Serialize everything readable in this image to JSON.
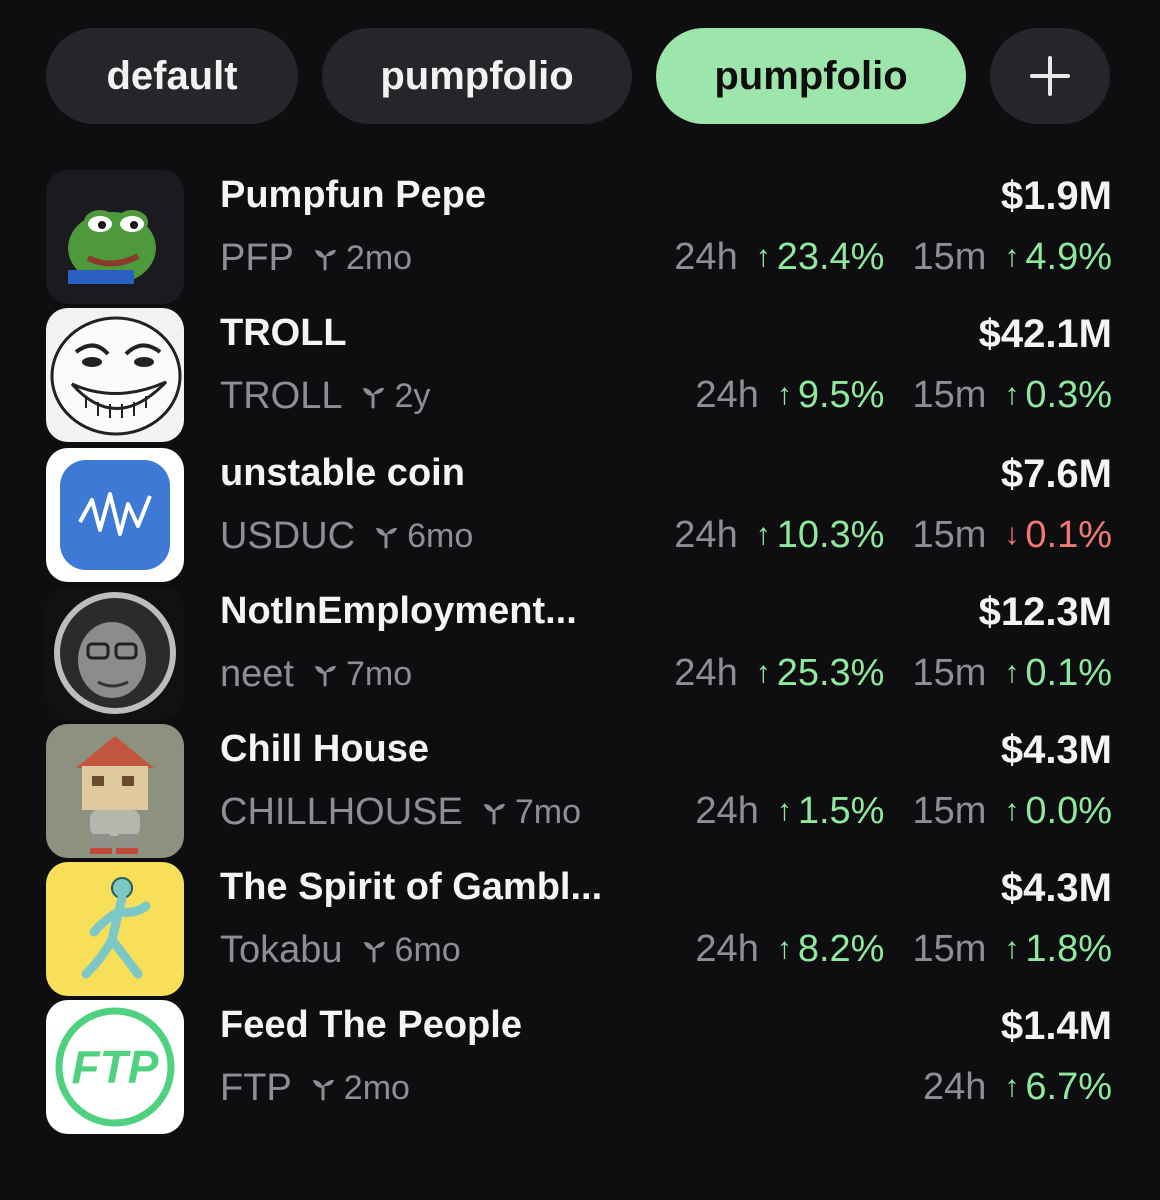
{
  "tabs": [
    {
      "label": "default",
      "active": false
    },
    {
      "label": "pumpfolio",
      "active": false
    },
    {
      "label": "pumpfolio",
      "active": true
    }
  ],
  "add_tab_icon": "plus-icon",
  "colors": {
    "accent": "#9ce6ab",
    "up": "#8ee89e",
    "down": "#f07a73",
    "muted": "#8e8e95",
    "background": "#0e0e11"
  },
  "coins": [
    {
      "name": "Pumpfun Pepe",
      "ticker": "PFP",
      "age": "2mo",
      "mcap": "$1.9M",
      "label_24h": "24h",
      "change_24h": "23.4%",
      "dir_24h": "up",
      "label_15m": "15m",
      "change_15m": "4.9%",
      "dir_15m": "up",
      "icon": "pepe-frog-icon"
    },
    {
      "name": "TROLL",
      "ticker": "TROLL",
      "age": "2y",
      "mcap": "$42.1M",
      "label_24h": "24h",
      "change_24h": "9.5%",
      "dir_24h": "up",
      "label_15m": "15m",
      "change_15m": "0.3%",
      "dir_15m": "up",
      "icon": "trollface-icon"
    },
    {
      "name": "unstable coin",
      "ticker": "USDUC",
      "age": "6mo",
      "mcap": "$7.6M",
      "label_24h": "24h",
      "change_24h": "10.3%",
      "dir_24h": "up",
      "label_15m": "15m",
      "change_15m": "0.1%",
      "dir_15m": "down",
      "icon": "zigzag-chart-icon"
    },
    {
      "name": "NotInEmployment...",
      "ticker": "neet",
      "age": "7mo",
      "mcap": "$12.3M",
      "label_24h": "24h",
      "change_24h": "25.3%",
      "dir_24h": "up",
      "label_15m": "15m",
      "change_15m": "0.1%",
      "dir_15m": "up",
      "icon": "neet-face-icon"
    },
    {
      "name": "Chill House",
      "ticker": "CHILLHOUSE",
      "age": "7mo",
      "mcap": "$4.3M",
      "label_24h": "24h",
      "change_24h": "1.5%",
      "dir_24h": "up",
      "label_15m": "15m",
      "change_15m": "0.0%",
      "dir_15m": "up",
      "icon": "house-head-icon"
    },
    {
      "name": "The Spirit of Gambl...",
      "ticker": "Tokabu",
      "age": "6mo",
      "mcap": "$4.3M",
      "label_24h": "24h",
      "change_24h": "8.2%",
      "dir_24h": "up",
      "label_15m": "15m",
      "change_15m": "1.8%",
      "dir_15m": "up",
      "icon": "running-spirit-icon"
    },
    {
      "name": "Feed The People",
      "ticker": "FTP",
      "age": "2mo",
      "mcap": "$1.4M",
      "label_24h": "24h",
      "change_24h": "6.7%",
      "dir_24h": "up",
      "label_15m": "",
      "change_15m": "",
      "dir_15m": "",
      "icon": "ftp-logo-icon",
      "logo_text": "FTP"
    }
  ]
}
